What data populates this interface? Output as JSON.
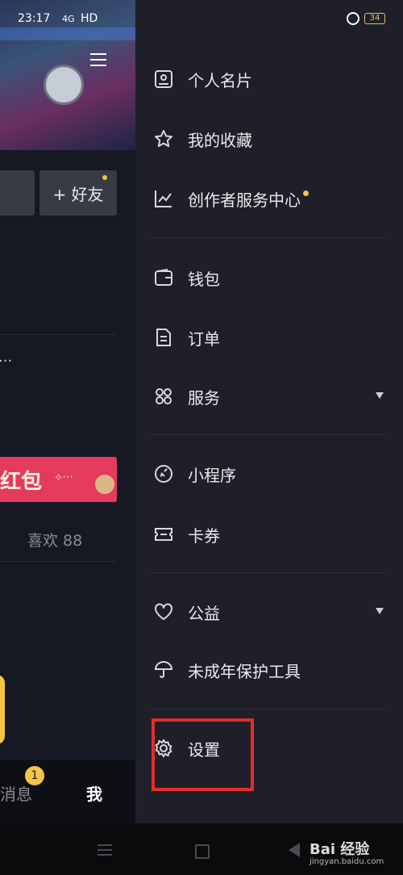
{
  "status_bar": {
    "time": "23:17",
    "network": "4G",
    "hd": "HD",
    "battery": "34"
  },
  "background_page": {
    "add_friend_label": "+ 好友",
    "ellipsis": "...",
    "banner_text": "红包",
    "likes_label": "喜欢 88",
    "nav": {
      "messages_label": "消息",
      "messages_badge": "1",
      "me_label": "我"
    }
  },
  "drawer": {
    "items": [
      {
        "label": "个人名片",
        "icon": "profile-card-icon"
      },
      {
        "label": "我的收藏",
        "icon": "star-icon"
      },
      {
        "label": "创作者服务中心",
        "icon": "trend-chart-icon",
        "new_dot": true
      },
      {
        "label": "钱包",
        "icon": "wallet-icon"
      },
      {
        "label": "订单",
        "icon": "order-document-icon"
      },
      {
        "label": "服务",
        "icon": "grid-services-icon",
        "expandable": true
      },
      {
        "label": "小程序",
        "icon": "link-icon"
      },
      {
        "label": "卡券",
        "icon": "ticket-icon"
      },
      {
        "label": "公益",
        "icon": "heart-icon",
        "expandable": true
      },
      {
        "label": "未成年保护工具",
        "icon": "umbrella-icon"
      },
      {
        "label": "设置",
        "icon": "gear-icon"
      }
    ],
    "highlight_color": "#e22d2a",
    "accent_color": "#f6c443"
  },
  "watermark": {
    "brand": "Bai 经验",
    "url": "jingyan.baidu.com"
  }
}
